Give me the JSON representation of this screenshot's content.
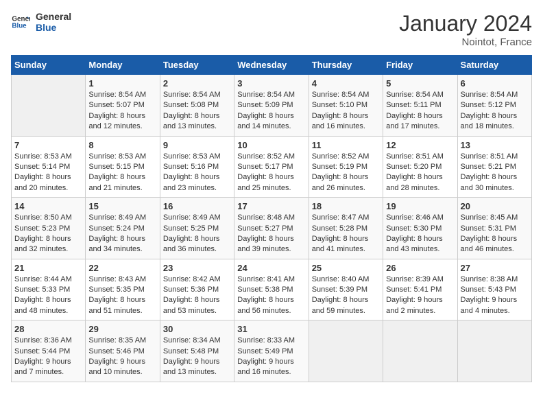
{
  "logo": {
    "line1": "General",
    "line2": "Blue"
  },
  "title": "January 2024",
  "subtitle": "Nointot, France",
  "headers": [
    "Sunday",
    "Monday",
    "Tuesday",
    "Wednesday",
    "Thursday",
    "Friday",
    "Saturday"
  ],
  "weeks": [
    [
      {
        "day": "",
        "sunrise": "",
        "sunset": "",
        "daylight": ""
      },
      {
        "day": "1",
        "sunrise": "Sunrise: 8:54 AM",
        "sunset": "Sunset: 5:07 PM",
        "daylight": "Daylight: 8 hours and 12 minutes."
      },
      {
        "day": "2",
        "sunrise": "Sunrise: 8:54 AM",
        "sunset": "Sunset: 5:08 PM",
        "daylight": "Daylight: 8 hours and 13 minutes."
      },
      {
        "day": "3",
        "sunrise": "Sunrise: 8:54 AM",
        "sunset": "Sunset: 5:09 PM",
        "daylight": "Daylight: 8 hours and 14 minutes."
      },
      {
        "day": "4",
        "sunrise": "Sunrise: 8:54 AM",
        "sunset": "Sunset: 5:10 PM",
        "daylight": "Daylight: 8 hours and 16 minutes."
      },
      {
        "day": "5",
        "sunrise": "Sunrise: 8:54 AM",
        "sunset": "Sunset: 5:11 PM",
        "daylight": "Daylight: 8 hours and 17 minutes."
      },
      {
        "day": "6",
        "sunrise": "Sunrise: 8:54 AM",
        "sunset": "Sunset: 5:12 PM",
        "daylight": "Daylight: 8 hours and 18 minutes."
      }
    ],
    [
      {
        "day": "7",
        "sunrise": "Sunrise: 8:53 AM",
        "sunset": "Sunset: 5:14 PM",
        "daylight": "Daylight: 8 hours and 20 minutes."
      },
      {
        "day": "8",
        "sunrise": "Sunrise: 8:53 AM",
        "sunset": "Sunset: 5:15 PM",
        "daylight": "Daylight: 8 hours and 21 minutes."
      },
      {
        "day": "9",
        "sunrise": "Sunrise: 8:53 AM",
        "sunset": "Sunset: 5:16 PM",
        "daylight": "Daylight: 8 hours and 23 minutes."
      },
      {
        "day": "10",
        "sunrise": "Sunrise: 8:52 AM",
        "sunset": "Sunset: 5:17 PM",
        "daylight": "Daylight: 8 hours and 25 minutes."
      },
      {
        "day": "11",
        "sunrise": "Sunrise: 8:52 AM",
        "sunset": "Sunset: 5:19 PM",
        "daylight": "Daylight: 8 hours and 26 minutes."
      },
      {
        "day": "12",
        "sunrise": "Sunrise: 8:51 AM",
        "sunset": "Sunset: 5:20 PM",
        "daylight": "Daylight: 8 hours and 28 minutes."
      },
      {
        "day": "13",
        "sunrise": "Sunrise: 8:51 AM",
        "sunset": "Sunset: 5:21 PM",
        "daylight": "Daylight: 8 hours and 30 minutes."
      }
    ],
    [
      {
        "day": "14",
        "sunrise": "Sunrise: 8:50 AM",
        "sunset": "Sunset: 5:23 PM",
        "daylight": "Daylight: 8 hours and 32 minutes."
      },
      {
        "day": "15",
        "sunrise": "Sunrise: 8:49 AM",
        "sunset": "Sunset: 5:24 PM",
        "daylight": "Daylight: 8 hours and 34 minutes."
      },
      {
        "day": "16",
        "sunrise": "Sunrise: 8:49 AM",
        "sunset": "Sunset: 5:25 PM",
        "daylight": "Daylight: 8 hours and 36 minutes."
      },
      {
        "day": "17",
        "sunrise": "Sunrise: 8:48 AM",
        "sunset": "Sunset: 5:27 PM",
        "daylight": "Daylight: 8 hours and 39 minutes."
      },
      {
        "day": "18",
        "sunrise": "Sunrise: 8:47 AM",
        "sunset": "Sunset: 5:28 PM",
        "daylight": "Daylight: 8 hours and 41 minutes."
      },
      {
        "day": "19",
        "sunrise": "Sunrise: 8:46 AM",
        "sunset": "Sunset: 5:30 PM",
        "daylight": "Daylight: 8 hours and 43 minutes."
      },
      {
        "day": "20",
        "sunrise": "Sunrise: 8:45 AM",
        "sunset": "Sunset: 5:31 PM",
        "daylight": "Daylight: 8 hours and 46 minutes."
      }
    ],
    [
      {
        "day": "21",
        "sunrise": "Sunrise: 8:44 AM",
        "sunset": "Sunset: 5:33 PM",
        "daylight": "Daylight: 8 hours and 48 minutes."
      },
      {
        "day": "22",
        "sunrise": "Sunrise: 8:43 AM",
        "sunset": "Sunset: 5:35 PM",
        "daylight": "Daylight: 8 hours and 51 minutes."
      },
      {
        "day": "23",
        "sunrise": "Sunrise: 8:42 AM",
        "sunset": "Sunset: 5:36 PM",
        "daylight": "Daylight: 8 hours and 53 minutes."
      },
      {
        "day": "24",
        "sunrise": "Sunrise: 8:41 AM",
        "sunset": "Sunset: 5:38 PM",
        "daylight": "Daylight: 8 hours and 56 minutes."
      },
      {
        "day": "25",
        "sunrise": "Sunrise: 8:40 AM",
        "sunset": "Sunset: 5:39 PM",
        "daylight": "Daylight: 8 hours and 59 minutes."
      },
      {
        "day": "26",
        "sunrise": "Sunrise: 8:39 AM",
        "sunset": "Sunset: 5:41 PM",
        "daylight": "Daylight: 9 hours and 2 minutes."
      },
      {
        "day": "27",
        "sunrise": "Sunrise: 8:38 AM",
        "sunset": "Sunset: 5:43 PM",
        "daylight": "Daylight: 9 hours and 4 minutes."
      }
    ],
    [
      {
        "day": "28",
        "sunrise": "Sunrise: 8:36 AM",
        "sunset": "Sunset: 5:44 PM",
        "daylight": "Daylight: 9 hours and 7 minutes."
      },
      {
        "day": "29",
        "sunrise": "Sunrise: 8:35 AM",
        "sunset": "Sunset: 5:46 PM",
        "daylight": "Daylight: 9 hours and 10 minutes."
      },
      {
        "day": "30",
        "sunrise": "Sunrise: 8:34 AM",
        "sunset": "Sunset: 5:48 PM",
        "daylight": "Daylight: 9 hours and 13 minutes."
      },
      {
        "day": "31",
        "sunrise": "Sunrise: 8:33 AM",
        "sunset": "Sunset: 5:49 PM",
        "daylight": "Daylight: 9 hours and 16 minutes."
      },
      {
        "day": "",
        "sunrise": "",
        "sunset": "",
        "daylight": ""
      },
      {
        "day": "",
        "sunrise": "",
        "sunset": "",
        "daylight": ""
      },
      {
        "day": "",
        "sunrise": "",
        "sunset": "",
        "daylight": ""
      }
    ]
  ]
}
